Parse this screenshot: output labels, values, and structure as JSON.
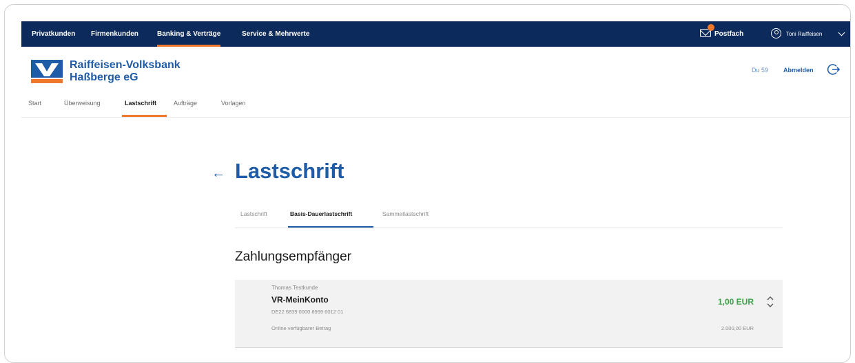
{
  "topbar": {
    "nav": [
      {
        "label": "Privatkunden",
        "active": false
      },
      {
        "label": "Firmenkunden",
        "active": false
      },
      {
        "label": "Banking & Verträge",
        "active": true
      },
      {
        "label": "Service & Mehrwerte",
        "active": false
      }
    ],
    "postfach_label": "Postfach",
    "user_label": "Toni Raiffeisen",
    "icons": [
      "mail-icon",
      "user-icon",
      "chevron-down-icon"
    ]
  },
  "bank": {
    "name_line1": "Raiffeisen-Volksbank",
    "name_line2": "Haßberge eG"
  },
  "header_actions": {
    "timer_label": "Du 59",
    "logout_label": "Abmelden"
  },
  "subnav": [
    {
      "label": "Start",
      "active": false
    },
    {
      "label": "Überweisung",
      "active": false
    },
    {
      "label": "Lastschrift",
      "active": true
    },
    {
      "label": "Aufträge",
      "active": false
    },
    {
      "label": "Vorlagen",
      "active": false
    }
  ],
  "main": {
    "title": "Lastschrift",
    "tabs": [
      {
        "label": "Lastschrift",
        "active": false
      },
      {
        "label": "Basis-Dauerlastschrift",
        "active": true
      },
      {
        "label": "Sammellastschrift",
        "active": false
      }
    ],
    "section_heading": "Zahlungsempfänger",
    "account": {
      "owner": "Thomas Testkunde",
      "name": "VR-MeinKonto",
      "iban": "DE22 6839 0000 8999 6012 01",
      "available_label": "Online verfügbarer Betrag",
      "available_value": "2.000,00 EUR",
      "balance": "1,00 EUR"
    }
  },
  "colors": {
    "topbar": "#0c2a5b",
    "brand_blue": "#1f5ca8",
    "accent_orange": "#f0782d",
    "balance_green": "#3ea14a"
  }
}
